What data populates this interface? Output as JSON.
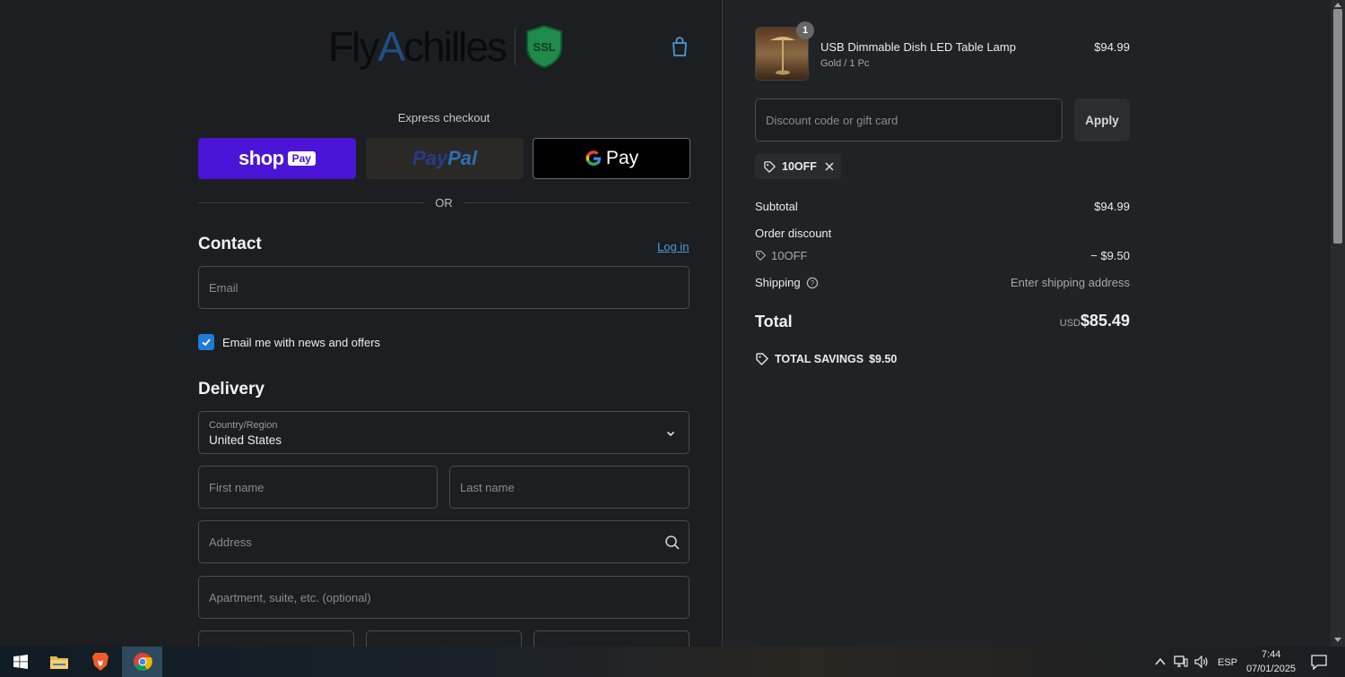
{
  "brand": {
    "logo_text_1": "Fly",
    "logo_text_a": "A",
    "logo_text_2": "chilles",
    "ssl_label": "SSL"
  },
  "express": {
    "label": "Express checkout",
    "shop_word": "shop",
    "shop_badge": "Pay",
    "paypal_pay": "Pay",
    "paypal_pal": "Pal",
    "gpay_word": "Pay",
    "or_text": "OR"
  },
  "contact": {
    "title": "Contact",
    "login_link": "Log in",
    "email_placeholder": "Email",
    "newsletter_label": "Email me with news and offers",
    "newsletter_checked": true
  },
  "delivery": {
    "title": "Delivery",
    "country_caption": "Country/Region",
    "country_value": "United States",
    "first_name_placeholder": "First name",
    "last_name_placeholder": "Last name",
    "address_placeholder": "Address",
    "apartment_placeholder": "Apartment, suite, etc. (optional)"
  },
  "cart": {
    "quantity": "1",
    "product_name": "USB Dimmable Dish LED Table Lamp",
    "variant": "Gold / 1 Pc",
    "price": "$94.99"
  },
  "discount": {
    "placeholder": "Discount code or gift card",
    "apply_label": "Apply",
    "applied_code": "10OFF"
  },
  "summary": {
    "subtotal_label": "Subtotal",
    "subtotal_value": "$94.99",
    "order_discount_label": "Order discount",
    "discount_code": "10OFF",
    "discount_value": "− $9.50",
    "shipping_label": "Shipping",
    "shipping_value": "Enter shipping address",
    "total_label": "Total",
    "total_currency": "USD",
    "total_value": "$85.49",
    "savings_label": "TOTAL SAVINGS",
    "savings_value": "$9.50"
  },
  "taskbar": {
    "language": "ESP",
    "time": "7:44",
    "date": "07/01/2025"
  },
  "colors": {
    "page_bg": "#1d1e21",
    "summary_bg": "#212225",
    "shop_pay": "#4b14d6",
    "link": "#4a9ad8",
    "checkbox": "#1f7bd8"
  }
}
